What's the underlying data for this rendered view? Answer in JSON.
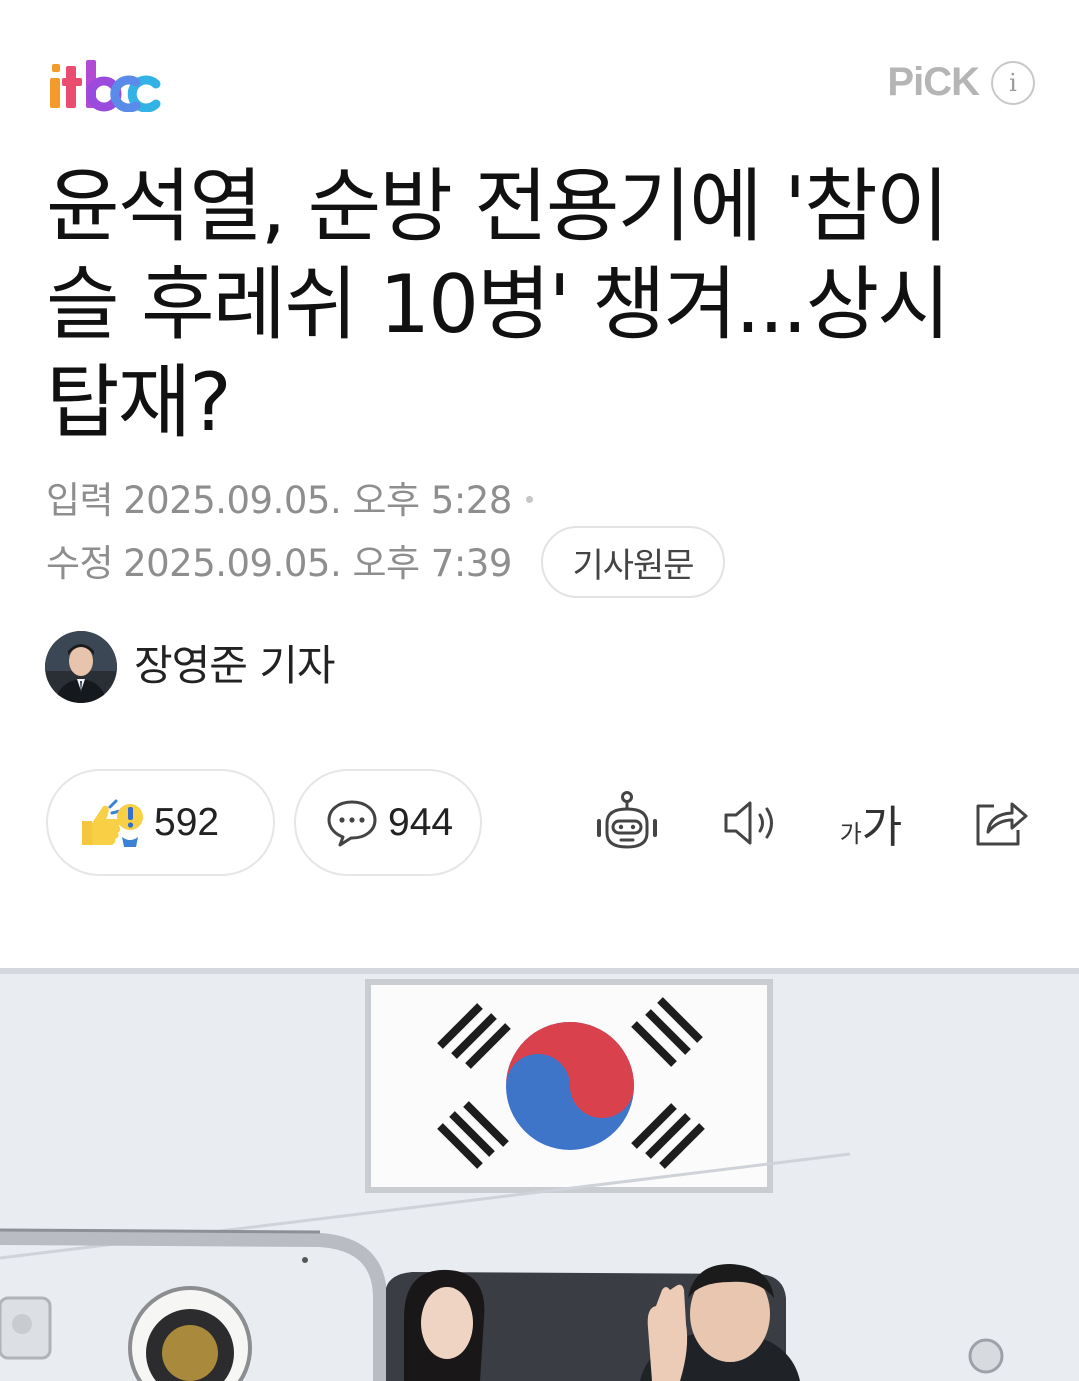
{
  "header": {
    "logo_text": "jtbc",
    "pick_label": "PiCK",
    "info_symbol": "i"
  },
  "article": {
    "title_line1": "윤석열, 순방 전용기에 '참이",
    "title_line2": "슬 후레쉬 10병' 챙겨...상시",
    "title_line3": "탑재?",
    "input_label": "입력",
    "input_datetime": "2025.09.05. 오후 5:28",
    "edit_label": "수정",
    "edit_datetime": "2025.09.05. 오후 7:39",
    "original_button": "기사원문",
    "reporter": "장영준 기자"
  },
  "actions": {
    "reaction_count": "592",
    "comment_count": "944",
    "font_small": "가",
    "font_big": "가"
  },
  "icons": [
    "reaction-icon",
    "comment-icon",
    "summary-bot-icon",
    "speaker-icon",
    "font-size-icon",
    "share-icon",
    "info-icon"
  ],
  "colors": {
    "flag_red": "#cd2e3a",
    "flag_blue": "#0047a0",
    "pick_gray": "#b5b5b5",
    "meta_gray": "#8e8e8e"
  }
}
